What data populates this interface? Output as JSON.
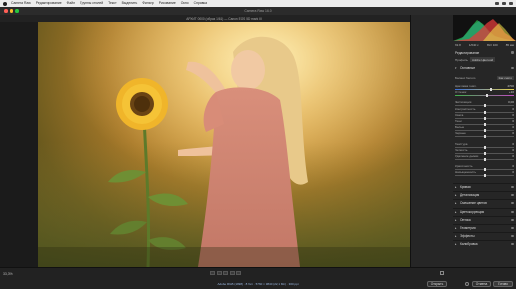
{
  "menu_bar": {
    "items": [
      "Camera Raw",
      "Редактирование",
      "Файл",
      "Группы стилей",
      "Текст",
      "Выделить",
      "Фильтр",
      "Рисование",
      "Окно",
      "Справка"
    ]
  },
  "window": {
    "title": "Camera Raw 16.0",
    "file_info": "АРХИТ 0000 (образ 1/61) — Canon EOS 5D mark III"
  },
  "histogram": {
    "readout": [
      "f/2.8",
      "1/640 с",
      "ISO 100",
      "85 мм"
    ]
  },
  "panel": {
    "title": "Редактирование",
    "profile_label": "Профиль",
    "profile_value": "Adobe Цветной",
    "basic_section": "Основные",
    "white_balance_label": "Баланс белого",
    "white_balance_value": "Как снято",
    "sliders": [
      {
        "label": "Цветовая темп.",
        "value": "4700",
        "pos": 0.62
      },
      {
        "label": "Оттенок",
        "value": "+10",
        "pos": 0.54
      },
      {
        "label": "Экспозиция",
        "value": "0,00",
        "pos": 0.5
      },
      {
        "label": "Контрастность",
        "value": "0",
        "pos": 0.5
      },
      {
        "label": "Света",
        "value": "0",
        "pos": 0.5
      },
      {
        "label": "Тени",
        "value": "0",
        "pos": 0.5
      },
      {
        "label": "Белые",
        "value": "0",
        "pos": 0.5
      },
      {
        "label": "Черные",
        "value": "0",
        "pos": 0.5
      },
      {
        "label": "Текстура",
        "value": "0",
        "pos": 0.5
      },
      {
        "label": "Четкость",
        "value": "0",
        "pos": 0.5
      },
      {
        "label": "Удаление дымки",
        "value": "0",
        "pos": 0.5
      },
      {
        "label": "Красочность",
        "value": "0",
        "pos": 0.5
      },
      {
        "label": "Насыщенность",
        "value": "0",
        "pos": 0.5
      }
    ],
    "sections": [
      "Кривая",
      "Детализация",
      "Смешение цветов",
      "Цветокоррекция",
      "Оптика",
      "Геометрия",
      "Эффекты",
      "Калибровка"
    ]
  },
  "bottom": {
    "zoom": "33,3%",
    "dims": "Adobe RGB (1998) · 8 бит · 5760 × 3840 (22,1 Мп) · 300 ppi",
    "open_label": "Открыть",
    "cancel_label": "Отмена",
    "done_label": "Готово"
  },
  "colors": {
    "accent": "#3b7de0",
    "panel_bg": "#262626",
    "canvas_bg": "#1b1b1b"
  }
}
